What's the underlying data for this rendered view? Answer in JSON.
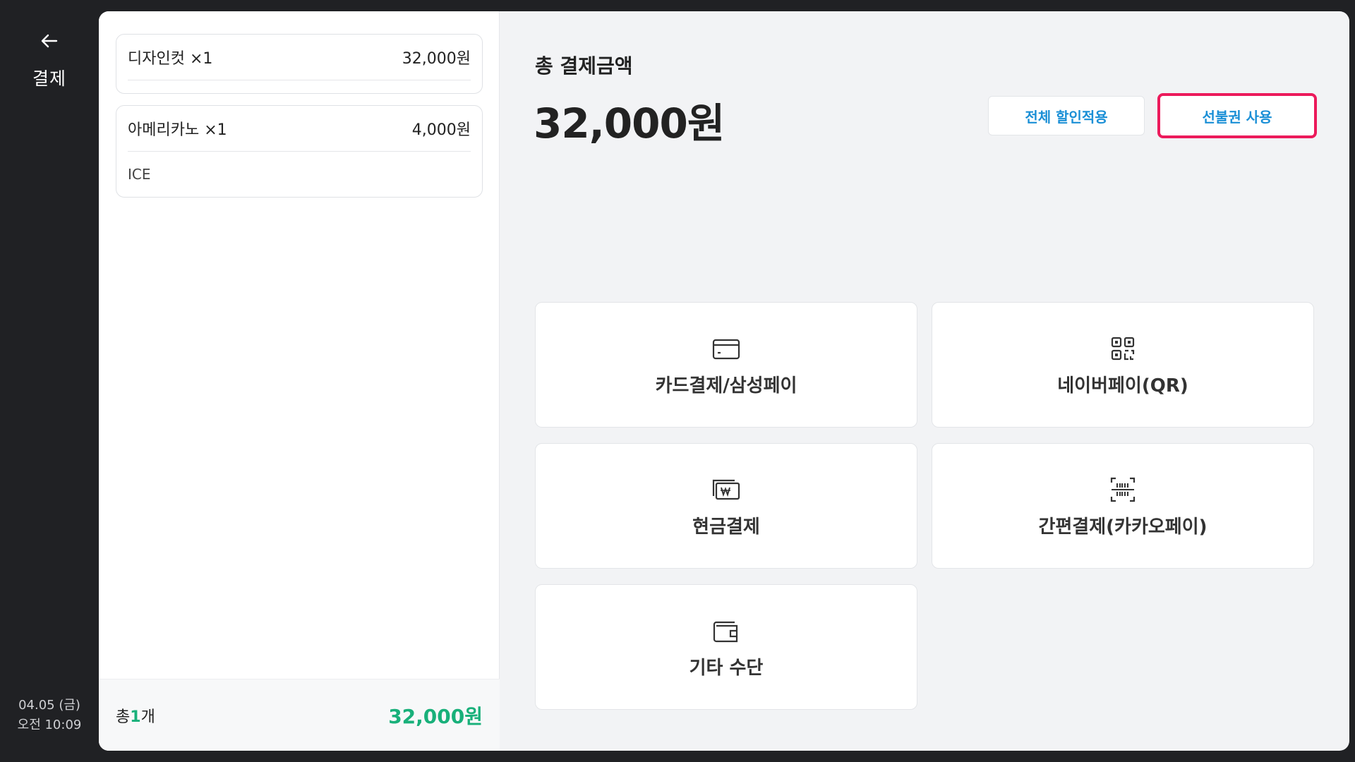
{
  "rail": {
    "back_label": "결제",
    "date": "04.05 (금)",
    "time": "오전 10:09"
  },
  "order": {
    "items": [
      {
        "name": "디자인컷 ×1",
        "price": "32,000원"
      },
      {
        "name": "아메리카노 ×1",
        "price": "4,000원",
        "option": "ICE"
      }
    ],
    "footer": {
      "count_prefix": "총",
      "count_value": "1",
      "count_suffix": "개",
      "total": "32,000원"
    }
  },
  "payment": {
    "total_label": "총 결제금액",
    "total_amount": "32,000원",
    "discount_button": "전체 할인적용",
    "voucher_button": "선불권 사용",
    "methods": [
      {
        "label": "카드결제/삼성페이",
        "icon": "credit-card-icon"
      },
      {
        "label": "네이버페이(QR)",
        "icon": "qr-code-icon"
      },
      {
        "label": "현금결제",
        "icon": "cash-icon"
      },
      {
        "label": "간편결제(카카오페이)",
        "icon": "barcode-scan-icon"
      },
      {
        "label": "기타 수단",
        "icon": "wallet-icon"
      }
    ]
  },
  "colors": {
    "accent_green": "#18b07a",
    "link_blue": "#1a8fd6",
    "highlight_pink": "#ec1a5b",
    "rail_bg": "#202124"
  }
}
